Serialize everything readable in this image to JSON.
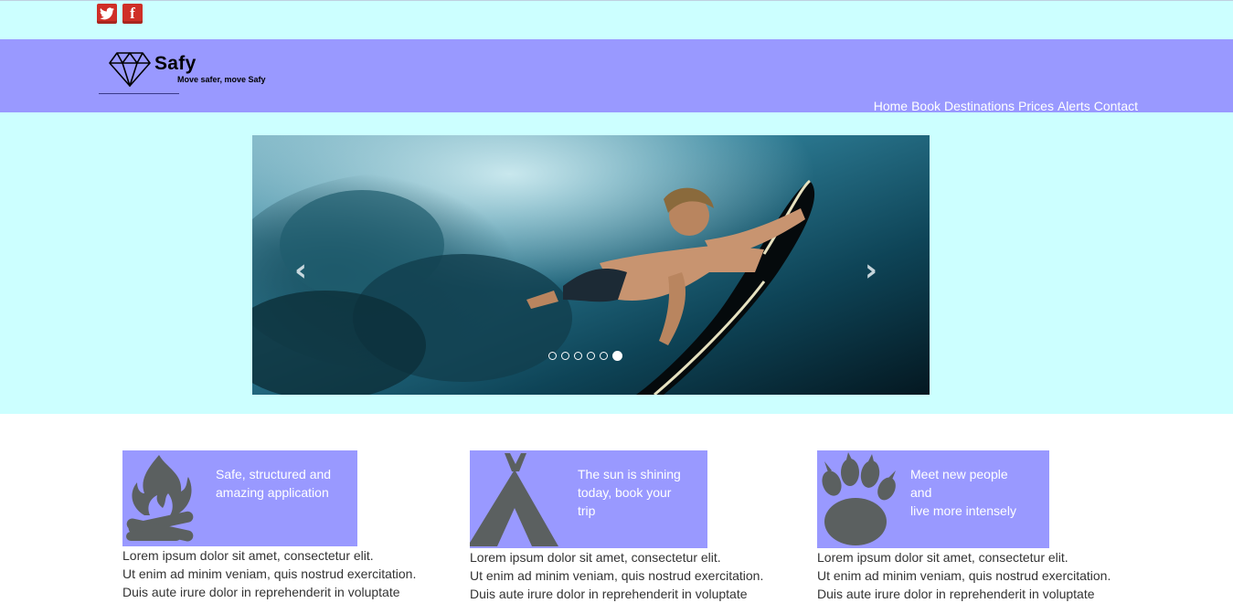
{
  "social": {
    "twitter": "twitter-icon",
    "facebook": "f"
  },
  "logo": {
    "name": "Safy",
    "tagline": "Move safer, move Safy"
  },
  "nav": [
    "Home",
    "Book",
    "Destinations",
    "Prices",
    "Alerts",
    "Contact"
  ],
  "carousel": {
    "prev": "‹",
    "next": "›",
    "slides": 6,
    "active_index": 5
  },
  "features": [
    {
      "icon": "campfire-icon",
      "caption": "Safe, structured and\namazing application",
      "body": "Lorem ipsum dolor sit amet, consectetur elit.\nUt enim ad minim veniam, quis nostrud exercitation.\nDuis aute irure dolor in reprehenderit in voluptate"
    },
    {
      "icon": "tent-icon",
      "caption": "The sun is shining\ntoday, book your\ntrip",
      "body": "Lorem ipsum dolor sit amet, consectetur elit.\nUt enim ad minim veniam, quis nostrud exercitation.\nDuis aute irure dolor in reprehenderit in voluptate"
    },
    {
      "icon": "paw-icon",
      "caption": "Meet new people\nand\nlive more intensely",
      "body": "Lorem ipsum dolor sit amet, consectetur elit.\nUt enim ad minim veniam, quis nostrud exercitation.\nDuis aute irure dolor in reprehenderit in voluptate"
    }
  ],
  "colors": {
    "topbar": "#ccffff",
    "header": "#9999ff",
    "card": "#9999ff",
    "icon": "#5b6060"
  }
}
